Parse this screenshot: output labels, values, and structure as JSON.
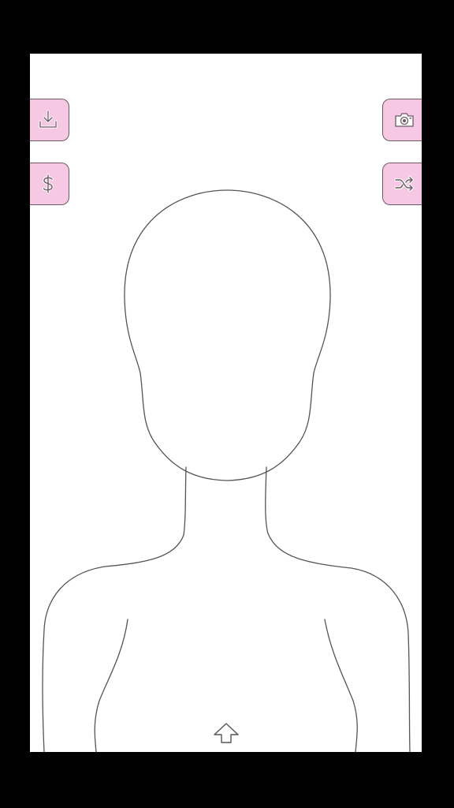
{
  "app": {
    "background_color": "#000000",
    "canvas_color": "#ffffff",
    "button_color": "#f7c8e4",
    "outline_color": "#555555"
  },
  "left_buttons": [
    {
      "icon": "download-icon"
    },
    {
      "icon": "dollar-icon"
    }
  ],
  "right_buttons": [
    {
      "icon": "camera-icon"
    },
    {
      "icon": "shuffle-icon"
    }
  ],
  "bottom": {
    "icon": "arrow-up-icon"
  }
}
